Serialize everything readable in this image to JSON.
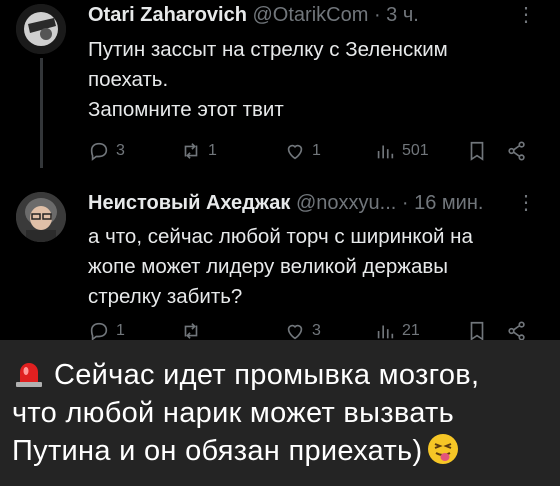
{
  "tweets": [
    {
      "name": "Otari Zaharovich",
      "handle": "@OtarikCom",
      "time": "· 3 ч.",
      "more": "⋮",
      "text_lines": [
        "Путин зассыт на стрелку с Зеленским",
        "поехать.",
        "Запомните этот твит"
      ],
      "replies": "3",
      "retweets": "1",
      "likes": "1",
      "views": "501"
    },
    {
      "name": "Неистовый Ахеджак",
      "handle": "@noxxyu...",
      "time": "· 16 мин.",
      "more": "⋮",
      "text_lines": [
        "а что, сейчас любой торч с ширинкой на",
        "жопе может лидеру великой державы",
        "стрелку забить?"
      ],
      "replies": "1",
      "retweets": "",
      "likes": "3",
      "views": "21"
    }
  ],
  "caption": {
    "lines": [
      "Сейчас идет промывка мозгов,",
      "что любой нарик может вызвать",
      "Путина и он обязан приехать)"
    ],
    "lead_icon": "police-siren-emoji",
    "trail_icon": "tongue-out-face-emoji"
  },
  "colors": {
    "background": "#000000",
    "text": "#e7e9ea",
    "muted": "#71767b",
    "caption_bg": "#242424",
    "divider": "#333639"
  }
}
